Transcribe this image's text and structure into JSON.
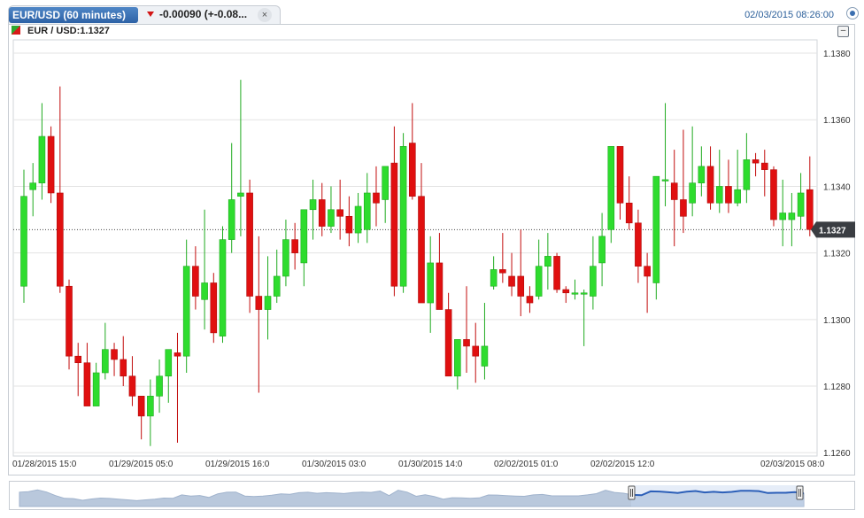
{
  "tab": {
    "title": "EUR/USD (60 minutes)",
    "change": "-0.00090 (+-0.08...",
    "close_glyph": "×"
  },
  "timestamp": "02/03/2015 08:26:00",
  "header": {
    "label": "EUR / USD:1.1327",
    "minimize_glyph": "–"
  },
  "colors": {
    "up": "#2edc2e",
    "down": "#e01010",
    "grid": "#e3e3e3",
    "axis_text": "#333333",
    "last_price_bg": "#3a3d42"
  },
  "chart_data": {
    "type": "candlestick",
    "ylim": [
      1.1259,
      1.1384
    ],
    "yticks": [
      1.138,
      1.136,
      1.134,
      1.132,
      1.13,
      1.128,
      1.126
    ],
    "ytick_labels": [
      "1.1380",
      "1.1360",
      "1.1340",
      "1.1320",
      "1.1300",
      "1.1280",
      "1.1260"
    ],
    "xtick_labels": [
      "01/28/2015 15:0",
      "01/29/2015 05:0",
      "01/29/2015 16:0",
      "01/30/2015 03:0",
      "01/30/2015 14:0",
      "02/02/2015 01:0",
      "02/02/2015 12:0",
      "02/03/2015 08:0"
    ],
    "last_price": 1.1327,
    "last_price_label": "1.1327",
    "candles": [
      [
        1.131,
        1.1345,
        1.1305,
        1.1337
      ],
      [
        1.1339,
        1.1347,
        1.1331,
        1.1341
      ],
      [
        1.1341,
        1.1365,
        1.1336,
        1.1355
      ],
      [
        1.1355,
        1.1358,
        1.1335,
        1.1338
      ],
      [
        1.1338,
        1.137,
        1.1308,
        1.131
      ],
      [
        1.131,
        1.1312,
        1.1285,
        1.1289
      ],
      [
        1.1289,
        1.1293,
        1.1277,
        1.1287
      ],
      [
        1.1287,
        1.1293,
        1.1275,
        1.1274
      ],
      [
        1.1274,
        1.1287,
        1.1275,
        1.1284
      ],
      [
        1.1284,
        1.1299,
        1.1282,
        1.1291
      ],
      [
        1.1291,
        1.1293,
        1.1283,
        1.1288
      ],
      [
        1.1288,
        1.1295,
        1.128,
        1.1283
      ],
      [
        1.1283,
        1.1289,
        1.1274,
        1.1277
      ],
      [
        1.1277,
        1.1277,
        1.1264,
        1.1271
      ],
      [
        1.1271,
        1.1282,
        1.1262,
        1.1277
      ],
      [
        1.1277,
        1.1288,
        1.1272,
        1.1283
      ],
      [
        1.1283,
        1.1291,
        1.1275,
        1.1291
      ],
      [
        1.129,
        1.1296,
        1.1263,
        1.1289
      ],
      [
        1.1289,
        1.1324,
        1.1284,
        1.1316
      ],
      [
        1.1316,
        1.1322,
        1.1303,
        1.1307
      ],
      [
        1.1306,
        1.1333,
        1.1297,
        1.1311
      ],
      [
        1.1311,
        1.1314,
        1.1293,
        1.1296
      ],
      [
        1.1295,
        1.1328,
        1.1293,
        1.1324
      ],
      [
        1.1324,
        1.1353,
        1.132,
        1.1336
      ],
      [
        1.1337,
        1.1372,
        1.1325,
        1.1338
      ],
      [
        1.1338,
        1.1342,
        1.1302,
        1.1307
      ],
      [
        1.1307,
        1.1325,
        1.1278,
        1.1303
      ],
      [
        1.1303,
        1.1319,
        1.1294,
        1.1307
      ],
      [
        1.1307,
        1.1321,
        1.1305,
        1.1313
      ],
      [
        1.1313,
        1.133,
        1.131,
        1.1324
      ],
      [
        1.1324,
        1.1329,
        1.1315,
        1.132
      ],
      [
        1.1317,
        1.1332,
        1.131,
        1.1333
      ],
      [
        1.1333,
        1.1342,
        1.1324,
        1.1336
      ],
      [
        1.1336,
        1.1341,
        1.1325,
        1.1328
      ],
      [
        1.1328,
        1.134,
        1.1326,
        1.1333
      ],
      [
        1.1333,
        1.1342,
        1.1324,
        1.1331
      ],
      [
        1.1331,
        1.1337,
        1.1322,
        1.1326
      ],
      [
        1.1326,
        1.1338,
        1.1323,
        1.1334
      ],
      [
        1.1327,
        1.1344,
        1.1323,
        1.1338
      ],
      [
        1.1338,
        1.1346,
        1.1328,
        1.1335
      ],
      [
        1.1336,
        1.1341,
        1.1329,
        1.1346
      ],
      [
        1.1347,
        1.1358,
        1.1307,
        1.131
      ],
      [
        1.131,
        1.1356,
        1.1308,
        1.1352
      ],
      [
        1.1353,
        1.1365,
        1.1336,
        1.1337
      ],
      [
        1.1337,
        1.1347,
        1.1305,
        1.1305
      ],
      [
        1.1305,
        1.1325,
        1.1296,
        1.1317
      ],
      [
        1.1317,
        1.1326,
        1.1304,
        1.1303
      ],
      [
        1.1303,
        1.1308,
        1.1283,
        1.1283
      ],
      [
        1.1283,
        1.1287,
        1.1279,
        1.1294
      ],
      [
        1.1294,
        1.131,
        1.1284,
        1.1292
      ],
      [
        1.1292,
        1.1299,
        1.1281,
        1.1289
      ],
      [
        1.1286,
        1.1305,
        1.1282,
        1.1292
      ],
      [
        1.131,
        1.1319,
        1.1309,
        1.1315
      ],
      [
        1.1315,
        1.1326,
        1.1311,
        1.1314
      ],
      [
        1.1313,
        1.132,
        1.1307,
        1.131
      ],
      [
        1.1313,
        1.1327,
        1.1301,
        1.1307
      ],
      [
        1.1307,
        1.131,
        1.1302,
        1.1305
      ],
      [
        1.1307,
        1.1324,
        1.1306,
        1.1316
      ],
      [
        1.1316,
        1.1326,
        1.1309,
        1.1319
      ],
      [
        1.1319,
        1.132,
        1.1308,
        1.1309
      ],
      [
        1.1309,
        1.131,
        1.1305,
        1.1308
      ],
      [
        1.1308,
        1.1312,
        1.1306,
        1.1308
      ],
      [
        1.1308,
        1.1309,
        1.1292,
        1.1308
      ],
      [
        1.1307,
        1.1325,
        1.1303,
        1.1316
      ],
      [
        1.1317,
        1.1332,
        1.131,
        1.1325
      ],
      [
        1.1327,
        1.1352,
        1.1323,
        1.1352
      ],
      [
        1.1352,
        1.1352,
        1.133,
        1.1335
      ],
      [
        1.1335,
        1.1343,
        1.1327,
        1.1329
      ],
      [
        1.1329,
        1.1333,
        1.1311,
        1.1316
      ],
      [
        1.1316,
        1.132,
        1.1302,
        1.1313
      ],
      [
        1.1311,
        1.1343,
        1.1306,
        1.1343
      ],
      [
        1.1342,
        1.1365,
        1.1334,
        1.1342
      ],
      [
        1.1341,
        1.1351,
        1.1322,
        1.1336
      ],
      [
        1.1336,
        1.1357,
        1.1326,
        1.1331
      ],
      [
        1.1335,
        1.1358,
        1.1331,
        1.1341
      ],
      [
        1.1341,
        1.1352,
        1.1337,
        1.1346
      ],
      [
        1.1346,
        1.1352,
        1.1333,
        1.1335
      ],
      [
        1.1335,
        1.1351,
        1.1332,
        1.134
      ],
      [
        1.134,
        1.1348,
        1.1332,
        1.1335
      ],
      [
        1.1335,
        1.1351,
        1.1334,
        1.1339
      ],
      [
        1.1339,
        1.1356,
        1.1335,
        1.1348
      ],
      [
        1.1348,
        1.135,
        1.1343,
        1.1347
      ],
      [
        1.1347,
        1.1351,
        1.1337,
        1.1345
      ],
      [
        1.1345,
        1.1346,
        1.1328,
        1.133
      ],
      [
        1.133,
        1.1342,
        1.1322,
        1.1332
      ],
      [
        1.133,
        1.1338,
        1.1322,
        1.1332
      ],
      [
        1.1331,
        1.1344,
        1.1327,
        1.1338
      ],
      [
        1.1339,
        1.1349,
        1.1325,
        1.1327
      ]
    ]
  }
}
